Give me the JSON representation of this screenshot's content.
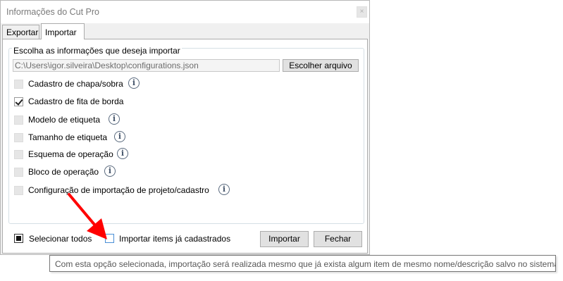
{
  "window": {
    "title": "Informações do Cut Pro",
    "close_glyph": "×"
  },
  "tabs": [
    {
      "label": "Exportar",
      "active": false
    },
    {
      "label": "Importar",
      "active": true
    }
  ],
  "group": {
    "title": "Escolha as informações que deseja importar",
    "file_path": "C:\\Users\\igor.silveira\\Desktop\\configurations.json",
    "choose_file_label": "Escolher arquivo"
  },
  "options": [
    {
      "label": "Cadastro de chapa/sobra",
      "checked": false,
      "info": true
    },
    {
      "label": "Cadastro de fita de borda",
      "checked": true,
      "info": false
    },
    {
      "label": "Modelo de etiqueta",
      "checked": false,
      "info": true
    },
    {
      "label": "Tamanho de etiqueta",
      "checked": false,
      "info": true
    },
    {
      "label": "Esquema de operação",
      "checked": false,
      "info": true
    },
    {
      "label": "Bloco de operação",
      "checked": false,
      "info": true
    },
    {
      "label": "Configuração de importação de projeto/cadastro",
      "checked": false,
      "info": true
    }
  ],
  "info_glyph": "i",
  "footer": {
    "select_all_label": "Selecionar todos",
    "import_existing_label": "Importar items já cadastrados",
    "import_button": "Importar",
    "close_button": "Fechar"
  },
  "tooltip": "Com esta opção selecionada, importação será realizada mesmo que já exista algum item de mesmo nome/descrição salvo no sistema.",
  "colors": {
    "accent": "#4a8fd6",
    "annotation_arrow": "#ff0000"
  },
  "icons": {
    "info": "info-circle-icon",
    "close": "close-icon",
    "arrow": "red-arrow-icon"
  }
}
